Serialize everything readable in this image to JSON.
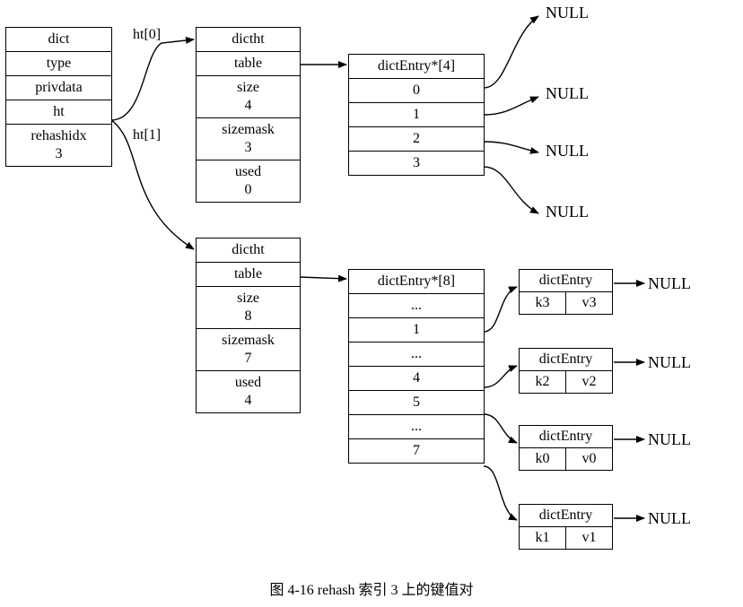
{
  "dict": {
    "title": "dict",
    "fields": {
      "type": "type",
      "privdata": "privdata",
      "ht": "ht",
      "rehashidx_label": "rehashidx",
      "rehashidx_value": "3"
    }
  },
  "edges": {
    "ht0": "ht[0]",
    "ht1": "ht[1]"
  },
  "dictht0": {
    "title": "dictht",
    "table": "table",
    "size_label": "size",
    "size_value": "4",
    "sizemask_label": "sizemask",
    "sizemask_value": "3",
    "used_label": "used",
    "used_value": "0"
  },
  "dictht1": {
    "title": "dictht",
    "table": "table",
    "size_label": "size",
    "size_value": "8",
    "sizemask_label": "sizemask",
    "sizemask_value": "7",
    "used_label": "used",
    "used_value": "4"
  },
  "arr4": {
    "header": "dictEntry*[4]",
    "slots": [
      "0",
      "1",
      "2",
      "3"
    ]
  },
  "arr8": {
    "header": "dictEntry*[8]",
    "slots": [
      "...",
      "1",
      "...",
      "4",
      "5",
      "...",
      "7"
    ]
  },
  "entries": [
    {
      "title": "dictEntry",
      "k": "k3",
      "v": "v3"
    },
    {
      "title": "dictEntry",
      "k": "k2",
      "v": "v2"
    },
    {
      "title": "dictEntry",
      "k": "k0",
      "v": "v0"
    },
    {
      "title": "dictEntry",
      "k": "k1",
      "v": "v1"
    }
  ],
  "null_label": "NULL",
  "caption": "图 4-16    rehash 索引 3 上的键值对"
}
